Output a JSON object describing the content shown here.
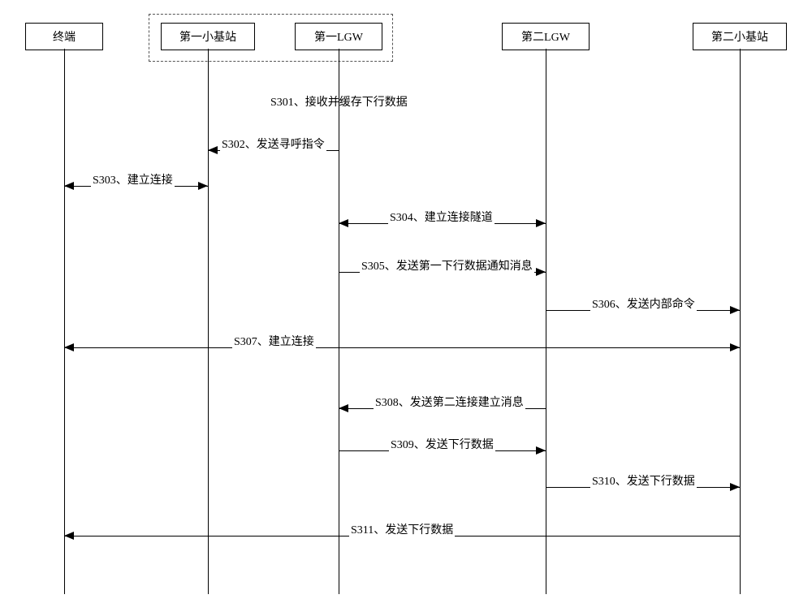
{
  "actors": {
    "terminal": "终端",
    "smallBS1": "第一小基站",
    "lgw1": "第一LGW",
    "lgw2": "第二LGW",
    "smallBS2": "第二小基站"
  },
  "messages": {
    "s301": "S301、接收并缓存下行数据",
    "s302": "S302、发送寻呼指令",
    "s303": "S303、建立连接",
    "s304": "S304、建立连接隧道",
    "s305": "S305、发送第一下行数据通知消息",
    "s306": "S306、发送内部命令",
    "s307": "S307、建立连接",
    "s308": "S308、发送第二连接建立消息",
    "s309": "S309、发送下行数据",
    "s310": "S310、发送下行数据",
    "s311": "S311、发送下行数据"
  },
  "chart_data": {
    "type": "sequence_diagram",
    "participants": [
      "终端",
      "第一小基站",
      "第一LGW",
      "第二LGW",
      "第二小基站"
    ],
    "grouping": {
      "group": [
        "第一小基站",
        "第一LGW"
      ],
      "style": "dashed"
    },
    "events": [
      {
        "id": "S301",
        "from": "第一LGW",
        "to": "第一LGW",
        "type": "self",
        "label": "接收并缓存下行数据"
      },
      {
        "id": "S302",
        "from": "第一LGW",
        "to": "第一小基站",
        "type": "message",
        "label": "发送寻呼指令"
      },
      {
        "id": "S303",
        "from": "终端",
        "to": "第一小基站",
        "type": "bidirectional",
        "label": "建立连接"
      },
      {
        "id": "S304",
        "from": "第一LGW",
        "to": "第二LGW",
        "type": "bidirectional",
        "label": "建立连接隧道"
      },
      {
        "id": "S305",
        "from": "第一LGW",
        "to": "第二LGW",
        "type": "message",
        "label": "发送第一下行数据通知消息"
      },
      {
        "id": "S306",
        "from": "第二LGW",
        "to": "第二小基站",
        "type": "message",
        "label": "发送内部命令"
      },
      {
        "id": "S307",
        "from": "终端",
        "to": "第二小基站",
        "type": "bidirectional",
        "label": "建立连接"
      },
      {
        "id": "S308",
        "from": "第二LGW",
        "to": "第一LGW",
        "type": "message",
        "label": "发送第二连接建立消息"
      },
      {
        "id": "S309",
        "from": "第一LGW",
        "to": "第二LGW",
        "type": "message",
        "label": "发送下行数据"
      },
      {
        "id": "S310",
        "from": "第二LGW",
        "to": "第二小基站",
        "type": "message",
        "label": "发送下行数据"
      },
      {
        "id": "S311",
        "from": "第二小基站",
        "to": "终端",
        "type": "message",
        "label": "发送下行数据"
      }
    ]
  }
}
